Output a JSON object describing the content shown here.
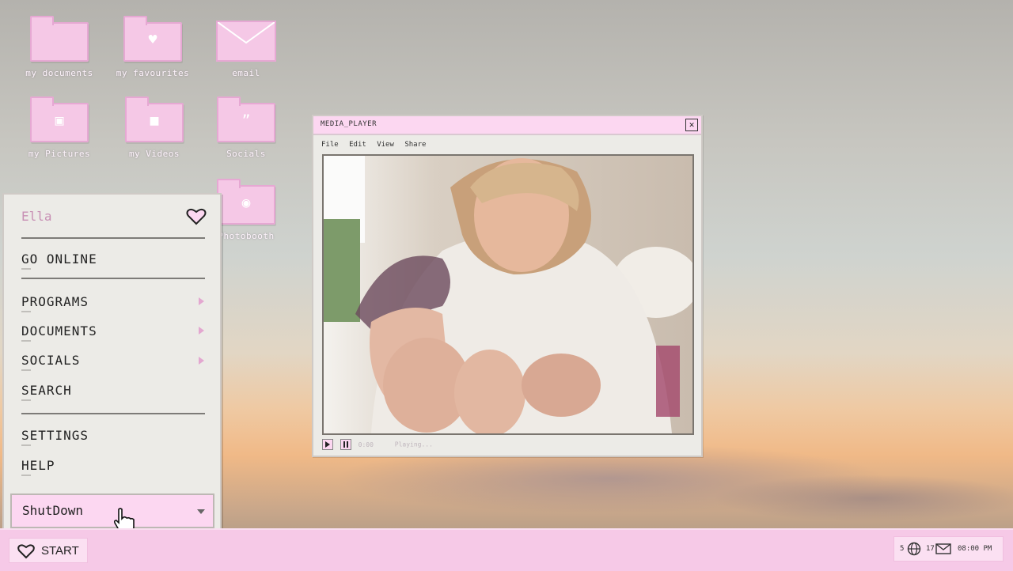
{
  "desktop": {
    "icons": [
      {
        "label": "my documents",
        "icon": "folder-icon"
      },
      {
        "label": "my favourites",
        "icon": "heart-folder-icon"
      },
      {
        "label": "email",
        "icon": "envelope-icon"
      },
      {
        "label": "my Pictures",
        "icon": "image-folder-icon"
      },
      {
        "label": "my Videos",
        "icon": "video-folder-icon"
      },
      {
        "label": "Socials",
        "icon": "quote-folder-icon"
      },
      {
        "label": "Photobooth",
        "icon": "camera-folder-icon"
      }
    ]
  },
  "start_menu": {
    "user": "Ella",
    "items": [
      {
        "label": "GO ONLINE"
      },
      {
        "label": "PROGRAMS",
        "submenu": true
      },
      {
        "label": "DOCUMENTS",
        "submenu": true
      },
      {
        "label": "SOCIALS",
        "submenu": true
      },
      {
        "label": "SEARCH"
      },
      {
        "label": "SETTINGS"
      },
      {
        "label": "HELP"
      }
    ],
    "shutdown_label": "ShutDown"
  },
  "media_player": {
    "title": "MEDIA_PLAYER",
    "menu": [
      "File",
      "Edit",
      "View",
      "Share"
    ],
    "time": "0:00",
    "status": "Playing..."
  },
  "taskbar": {
    "start_label": "START",
    "tray": {
      "count1": "5",
      "count2": "17",
      "time": "08:00 PM"
    }
  },
  "colors": {
    "accent_pink": "#f6c9e7",
    "menu_bg": "#ecebe7"
  }
}
